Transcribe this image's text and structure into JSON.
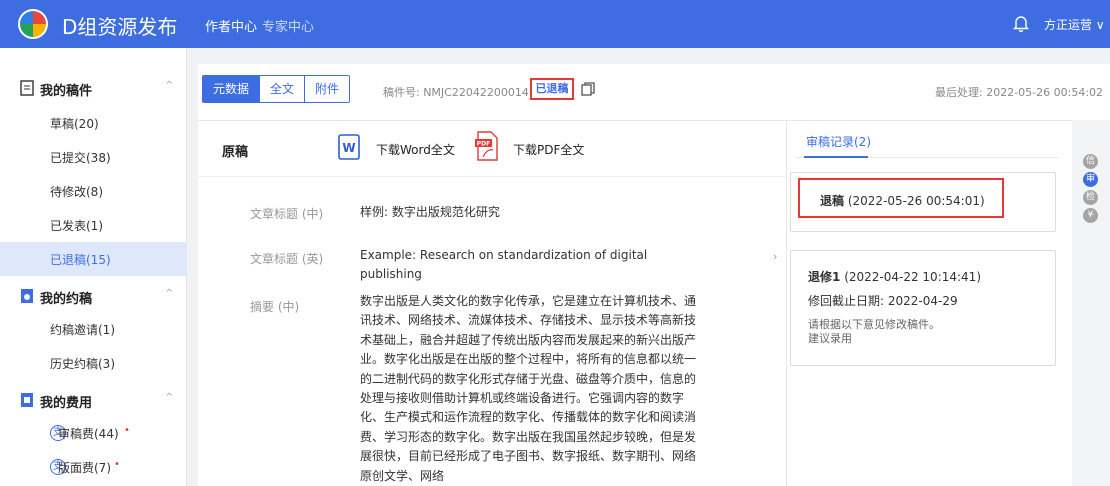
{
  "header": {
    "app_title": "D组资源发布",
    "nav": [
      {
        "label": "作者中心"
      },
      {
        "label": "专家中心"
      }
    ],
    "user_label": "方正运营 ∨"
  },
  "sidebar": {
    "sections": [
      {
        "title": "我的稿件",
        "items": [
          {
            "label": "草稿(20)"
          },
          {
            "label": "已提交(38)"
          },
          {
            "label": "待修改(8)"
          },
          {
            "label": "已发表(1)"
          },
          {
            "label": "已退稿(15)"
          }
        ]
      },
      {
        "title": "我的约稿",
        "items": [
          {
            "label": "约稿邀请(1)"
          },
          {
            "label": "历史约稿(3)"
          }
        ]
      },
      {
        "title": "我的费用",
        "items": [
          {
            "label": "审稿费(44)",
            "badge": "支"
          },
          {
            "label": "版面费(7)",
            "badge": "支"
          }
        ]
      }
    ],
    "active_item": "已退稿(15)",
    "collapse_glyph": "^",
    "dot": "•"
  },
  "manuscript": {
    "tabs": [
      {
        "label": "元数据"
      },
      {
        "label": "全文"
      },
      {
        "label": "附件"
      }
    ],
    "active_tab": "元数据",
    "number_text": "稿件号: NMJC22042200014",
    "status": "已退稿",
    "last_processed": "最后处理: 2022-05-26 00:54:02"
  },
  "original": {
    "label": "原稿",
    "download_word": "下载Word全文",
    "download_pdf": "下载PDF全文",
    "word_icon_text": "W",
    "pdf_icon_text": "PDF",
    "fields": [
      {
        "label": "文章标题 (中)",
        "value": "样例: 数字出版规范化研究"
      },
      {
        "label": "文章标题 (英)",
        "value": "Example: Research on standardization of digital publishing"
      },
      {
        "label": "摘要 (中)",
        "value": "数字出版是人类文化的数字化传承，它是建立在计算机技术、通讯技术、网络技术、流媒体技术、存储技术、显示技术等高新技术基础上，融合并超越了传统出版内容而发展起来的新兴出版产业。数字化出版是在出版的整个过程中，将所有的信息都以统一的二进制代码的数字化形式存储于光盘、磁盘等介质中，信息的处理与接收则借助计算机或终端设备进行。它强调内容的数字化、生产模式和运作流程的数字化、传播载体的数字化和阅读消费、学习形态的数字化。数字出版在我国虽然起步较晚，但是发展很快，目前已经形成了电子图书、数字报纸、数字期刊、网络原创文学、网络"
      }
    ],
    "expand_glyph": "›"
  },
  "review": {
    "tab_label": "审稿记录(2)",
    "records": [
      {
        "title": "退稿",
        "time": "(2022-05-26 00:54:01)"
      },
      {
        "title": "退修1",
        "time": "(2022-04-22 10:14:41)",
        "deadline": "修回截止日期:  2022-04-29",
        "notes": [
          "请根据以下意见修改稿件。",
          "建议录用"
        ]
      }
    ]
  },
  "right_rail": {
    "items": [
      {
        "label": "信"
      },
      {
        "label": "审",
        "active": true
      },
      {
        "label": "检"
      },
      {
        "label": "¥"
      }
    ]
  },
  "colors": {
    "primary": "#3d6de0",
    "highlight": "#e53935",
    "sidebar_active": "#dfe8fb"
  }
}
